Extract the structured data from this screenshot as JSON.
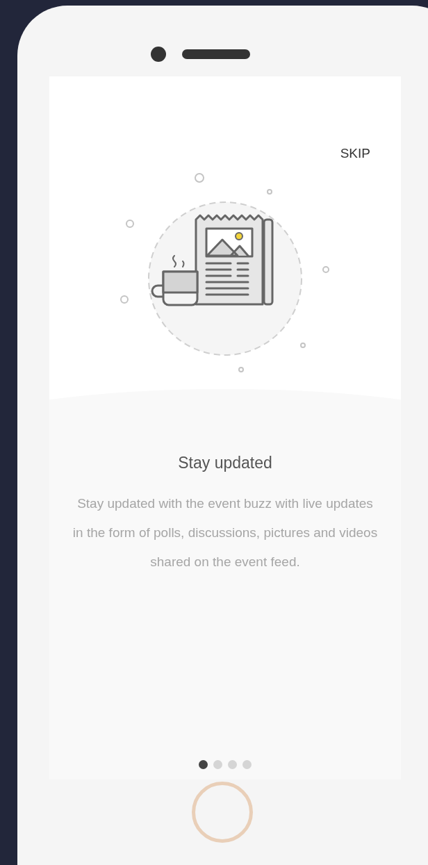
{
  "skip_button": {
    "label": "SKIP"
  },
  "slide": {
    "title": "Stay updated",
    "description": "Stay updated with the event buzz with live updates in the form of polls, discussions, pictures and videos shared on the event feed."
  },
  "page_indicator": [
    {
      "selected": true
    },
    {
      "selected": false
    },
    {
      "selected": false
    },
    {
      "selected": false
    }
  ]
}
